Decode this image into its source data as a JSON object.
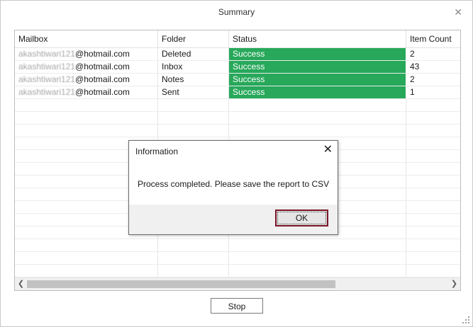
{
  "window": {
    "title": "Summary",
    "close_glyph": "✕"
  },
  "grid": {
    "columns": [
      "Mailbox",
      "Folder",
      "Status",
      "Item Count"
    ],
    "rows": [
      {
        "mailbox_user": "akashtiwari121",
        "mailbox_domain": "@hotmail.com",
        "folder": "Deleted",
        "status": "Success",
        "count": "2"
      },
      {
        "mailbox_user": "akashtiwari121",
        "mailbox_domain": "@hotmail.com",
        "folder": "Inbox",
        "status": "Success",
        "count": "43"
      },
      {
        "mailbox_user": "akashtiwari121",
        "mailbox_domain": "@hotmail.com",
        "folder": "Notes",
        "status": "Success",
        "count": "2"
      },
      {
        "mailbox_user": "akashtiwari121",
        "mailbox_domain": "@hotmail.com",
        "folder": "Sent",
        "status": "Success",
        "count": "1"
      }
    ],
    "scroll_left_glyph": "❮",
    "scroll_right_glyph": "❯"
  },
  "buttons": {
    "stop_label": "Stop"
  },
  "dialog": {
    "title": "Information",
    "close_glyph": "✕",
    "message": "Process completed. Please save the report to CSV",
    "ok_label": "OK"
  },
  "colors": {
    "success": "#27a85a",
    "ok_focus_border": "#7a1526"
  },
  "icons": [
    "close-icon",
    "scroll-left-icon",
    "scroll-right-icon",
    "resize-grip-icon"
  ]
}
